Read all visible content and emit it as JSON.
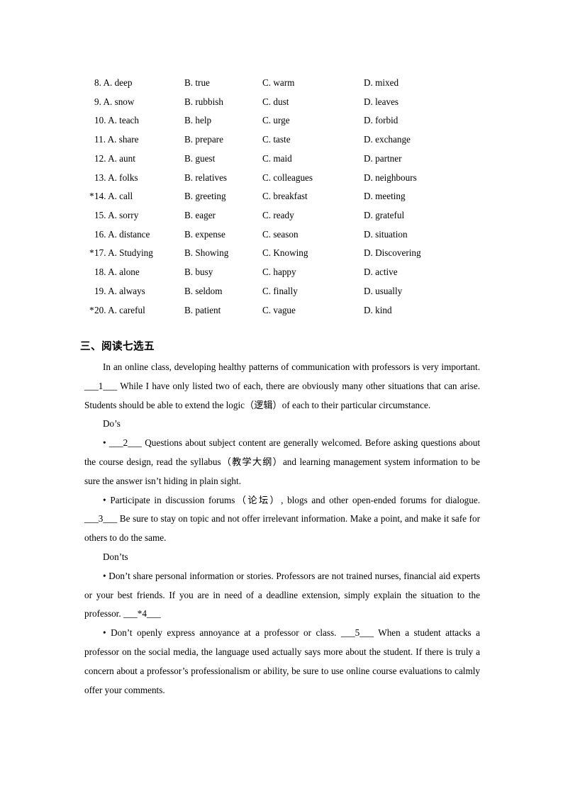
{
  "document": {
    "page_background": "#ffffff",
    "text_color": "#000000"
  },
  "cloze_options": {
    "columns": [
      "A",
      "B",
      "C",
      "D"
    ],
    "rows": [
      {
        "number": "8.",
        "starred": "",
        "a": "A. deep",
        "b": "B. true",
        "c": "C. warm",
        "d": "D. mixed"
      },
      {
        "number": "9.",
        "starred": "",
        "a": "A. snow",
        "b": "B. rubbish",
        "c": "C. dust",
        "d": "D. leaves"
      },
      {
        "number": "10.",
        "starred": "",
        "a": "A. teach",
        "b": "B. help",
        "c": "C. urge",
        "d": "D. forbid"
      },
      {
        "number": "11.",
        "starred": "",
        "a": "A. share",
        "b": "B. prepare",
        "c": "C. taste",
        "d": "D. exchange"
      },
      {
        "number": "12.",
        "starred": "",
        "a": "A. aunt",
        "b": "B. guest",
        "c": "C. maid",
        "d": "D. partner"
      },
      {
        "number": "13.",
        "starred": "",
        "a": "A. folks",
        "b": "B. relatives",
        "c": "C. colleagues",
        "d": "D. neighbours"
      },
      {
        "number": "14.",
        "starred": "*",
        "a": "A. call",
        "b": "B. greeting",
        "c": "C. breakfast",
        "d": "D. meeting"
      },
      {
        "number": "15.",
        "starred": "",
        "a": "A. sorry",
        "b": "B. eager",
        "c": "C. ready",
        "d": "D. grateful"
      },
      {
        "number": "16.",
        "starred": "",
        "a": "A. distance",
        "b": "B. expense",
        "c": "C. season",
        "d": "D. situation"
      },
      {
        "number": "17.",
        "starred": "*",
        "a": "A. Studying",
        "b": "B. Showing",
        "c": "C. Knowing",
        "d": "D. Discovering"
      },
      {
        "number": "18.",
        "starred": "",
        "a": "A. alone",
        "b": "B. busy",
        "c": "C. happy",
        "d": "D. active"
      },
      {
        "number": "19.",
        "starred": "",
        "a": "A. always",
        "b": "B. seldom",
        "c": "C. finally",
        "d": "D. usually"
      },
      {
        "number": "20.",
        "starred": "*",
        "a": "A. careful",
        "b": "B. patient",
        "c": "C. vague",
        "d": "D. kind"
      }
    ]
  },
  "reading_section": {
    "heading": "三、阅读七选五",
    "intro_paragraph": "In an online class, developing healthy patterns of communication with professors is very important. ___1___ While I have only listed two of each, there are obviously many other situations that can arise. Students should be able to extend the logic（逻辑）of each to their particular circumstance.",
    "dos_label": "Do’s",
    "dos_item_1": "• ___2___ Questions about subject content are generally welcomed. Before asking questions about the course design, read the syllabus（教学大纲）and learning management system information to be sure the answer isn’t hiding in plain sight.",
    "dos_item_2": "• Participate in discussion forums（论坛）, blogs and other open-ended forums for dialogue. ___3___ Be sure to stay on topic and not offer irrelevant information. Make a point, and make it safe for others to do the same.",
    "donts_label": "Don’ts",
    "donts_item_1": "• Don’t share personal information or stories. Professors are not trained nurses, financial aid experts or your best friends. If you are in need of a deadline extension, simply explain the situation to the professor. ___*4___",
    "donts_item_2": "• Don’t openly express annoyance at a professor or class. ___5___ When a student attacks a professor on the social media, the language used actually says more about the student. If there is truly a concern about a professor’s professionalism or ability, be sure to use online course evaluations to calmly offer your comments."
  }
}
